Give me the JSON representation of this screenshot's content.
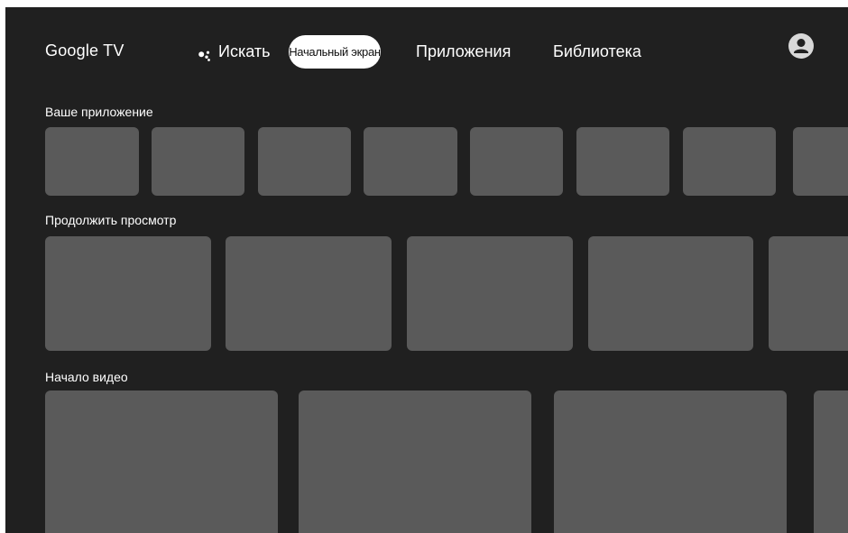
{
  "header": {
    "brand": "Google TV",
    "nav": {
      "search_label": "Искать",
      "home_label": "Начальный экран",
      "apps_label": "Приложения",
      "library_label": "Библиотека"
    },
    "active_tab": "Начальный экран"
  },
  "rows": [
    {
      "title": "Ваше приложение"
    },
    {
      "title": "Продолжить просмотр"
    },
    {
      "title": "Начало видео"
    }
  ],
  "icons": {
    "search": "assistant-icon",
    "profile": "account-icon"
  },
  "colors": {
    "background": "#202020",
    "tile": "#5a5a5a",
    "active_tab_bg": "#ffffff",
    "text": "#ffffff"
  }
}
